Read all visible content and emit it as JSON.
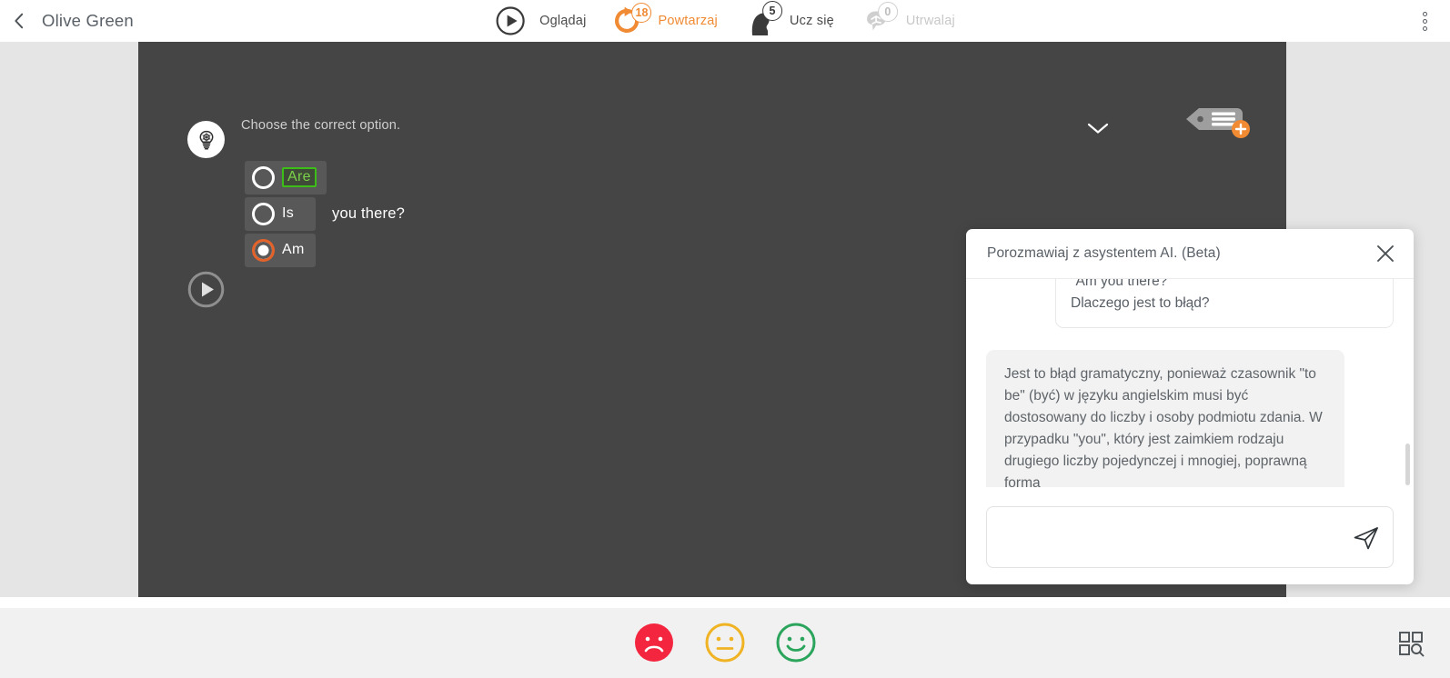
{
  "header": {
    "back_icon": "chevron-left-icon",
    "course_title": "Olive Green",
    "menu_icon": "kebab-menu-icon",
    "tabs": [
      {
        "label": "Oglądaj",
        "icon": "play-circle-icon",
        "badge": null,
        "state": "dark"
      },
      {
        "label": "Powtarzaj",
        "icon": "repeat-circle-icon",
        "badge": "18",
        "state": "active"
      },
      {
        "label": "Ucz się",
        "icon": "head-profile-icon",
        "badge": "5",
        "state": "dark"
      },
      {
        "label": "Utrwalaj",
        "icon": "brain-speech-icon",
        "badge": "0",
        "state": "muted"
      }
    ]
  },
  "stage": {
    "hint_icon": "lightbulb-icon",
    "prompt": "Choose the correct option.",
    "collapse_icon": "chevron-down-icon",
    "tag_icon": "tag-add-icon",
    "play_icon": "play-circle-outline-icon",
    "options": [
      {
        "label": "Are",
        "selected": false,
        "correct": true
      },
      {
        "label": "Is",
        "selected": false,
        "correct": false
      },
      {
        "label": "Am",
        "selected": true,
        "correct": false
      }
    ],
    "sentence_tail": "you there?"
  },
  "chat": {
    "title": "Porozmawiaj z asystentem AI. (Beta)",
    "close_icon": "close-icon",
    "messages": [
      {
        "role": "user",
        "line1": "\"Am you there?\"",
        "line2": "Dlaczego jest to błąd?"
      },
      {
        "role": "assistant",
        "text": "Jest to błąd gramatyczny, ponieważ czasownik \"to be\" (być) w języku angielskim musi być dostosowany do liczby i osoby podmiotu zdania. W przypadku \"you\", który jest zaimkiem rodzaju drugiego liczby pojedynczej i mnogiej, poprawną formą"
      }
    ],
    "input_value": "",
    "input_placeholder": "",
    "send_icon": "send-paper-plane-icon"
  },
  "footer": {
    "faces": [
      {
        "name": "sad",
        "color": "#f4263f"
      },
      {
        "name": "neutral",
        "color": "#f0b323"
      },
      {
        "name": "happy",
        "color": "#2ba45c"
      }
    ],
    "grid_icon": "grid-search-icon"
  },
  "colors": {
    "accent_orange": "#f08a33",
    "selected_orange": "#e2622a",
    "correct_green": "#3dbd18",
    "stage_bg": "#454545",
    "page_bg": "#e5e5e5"
  }
}
